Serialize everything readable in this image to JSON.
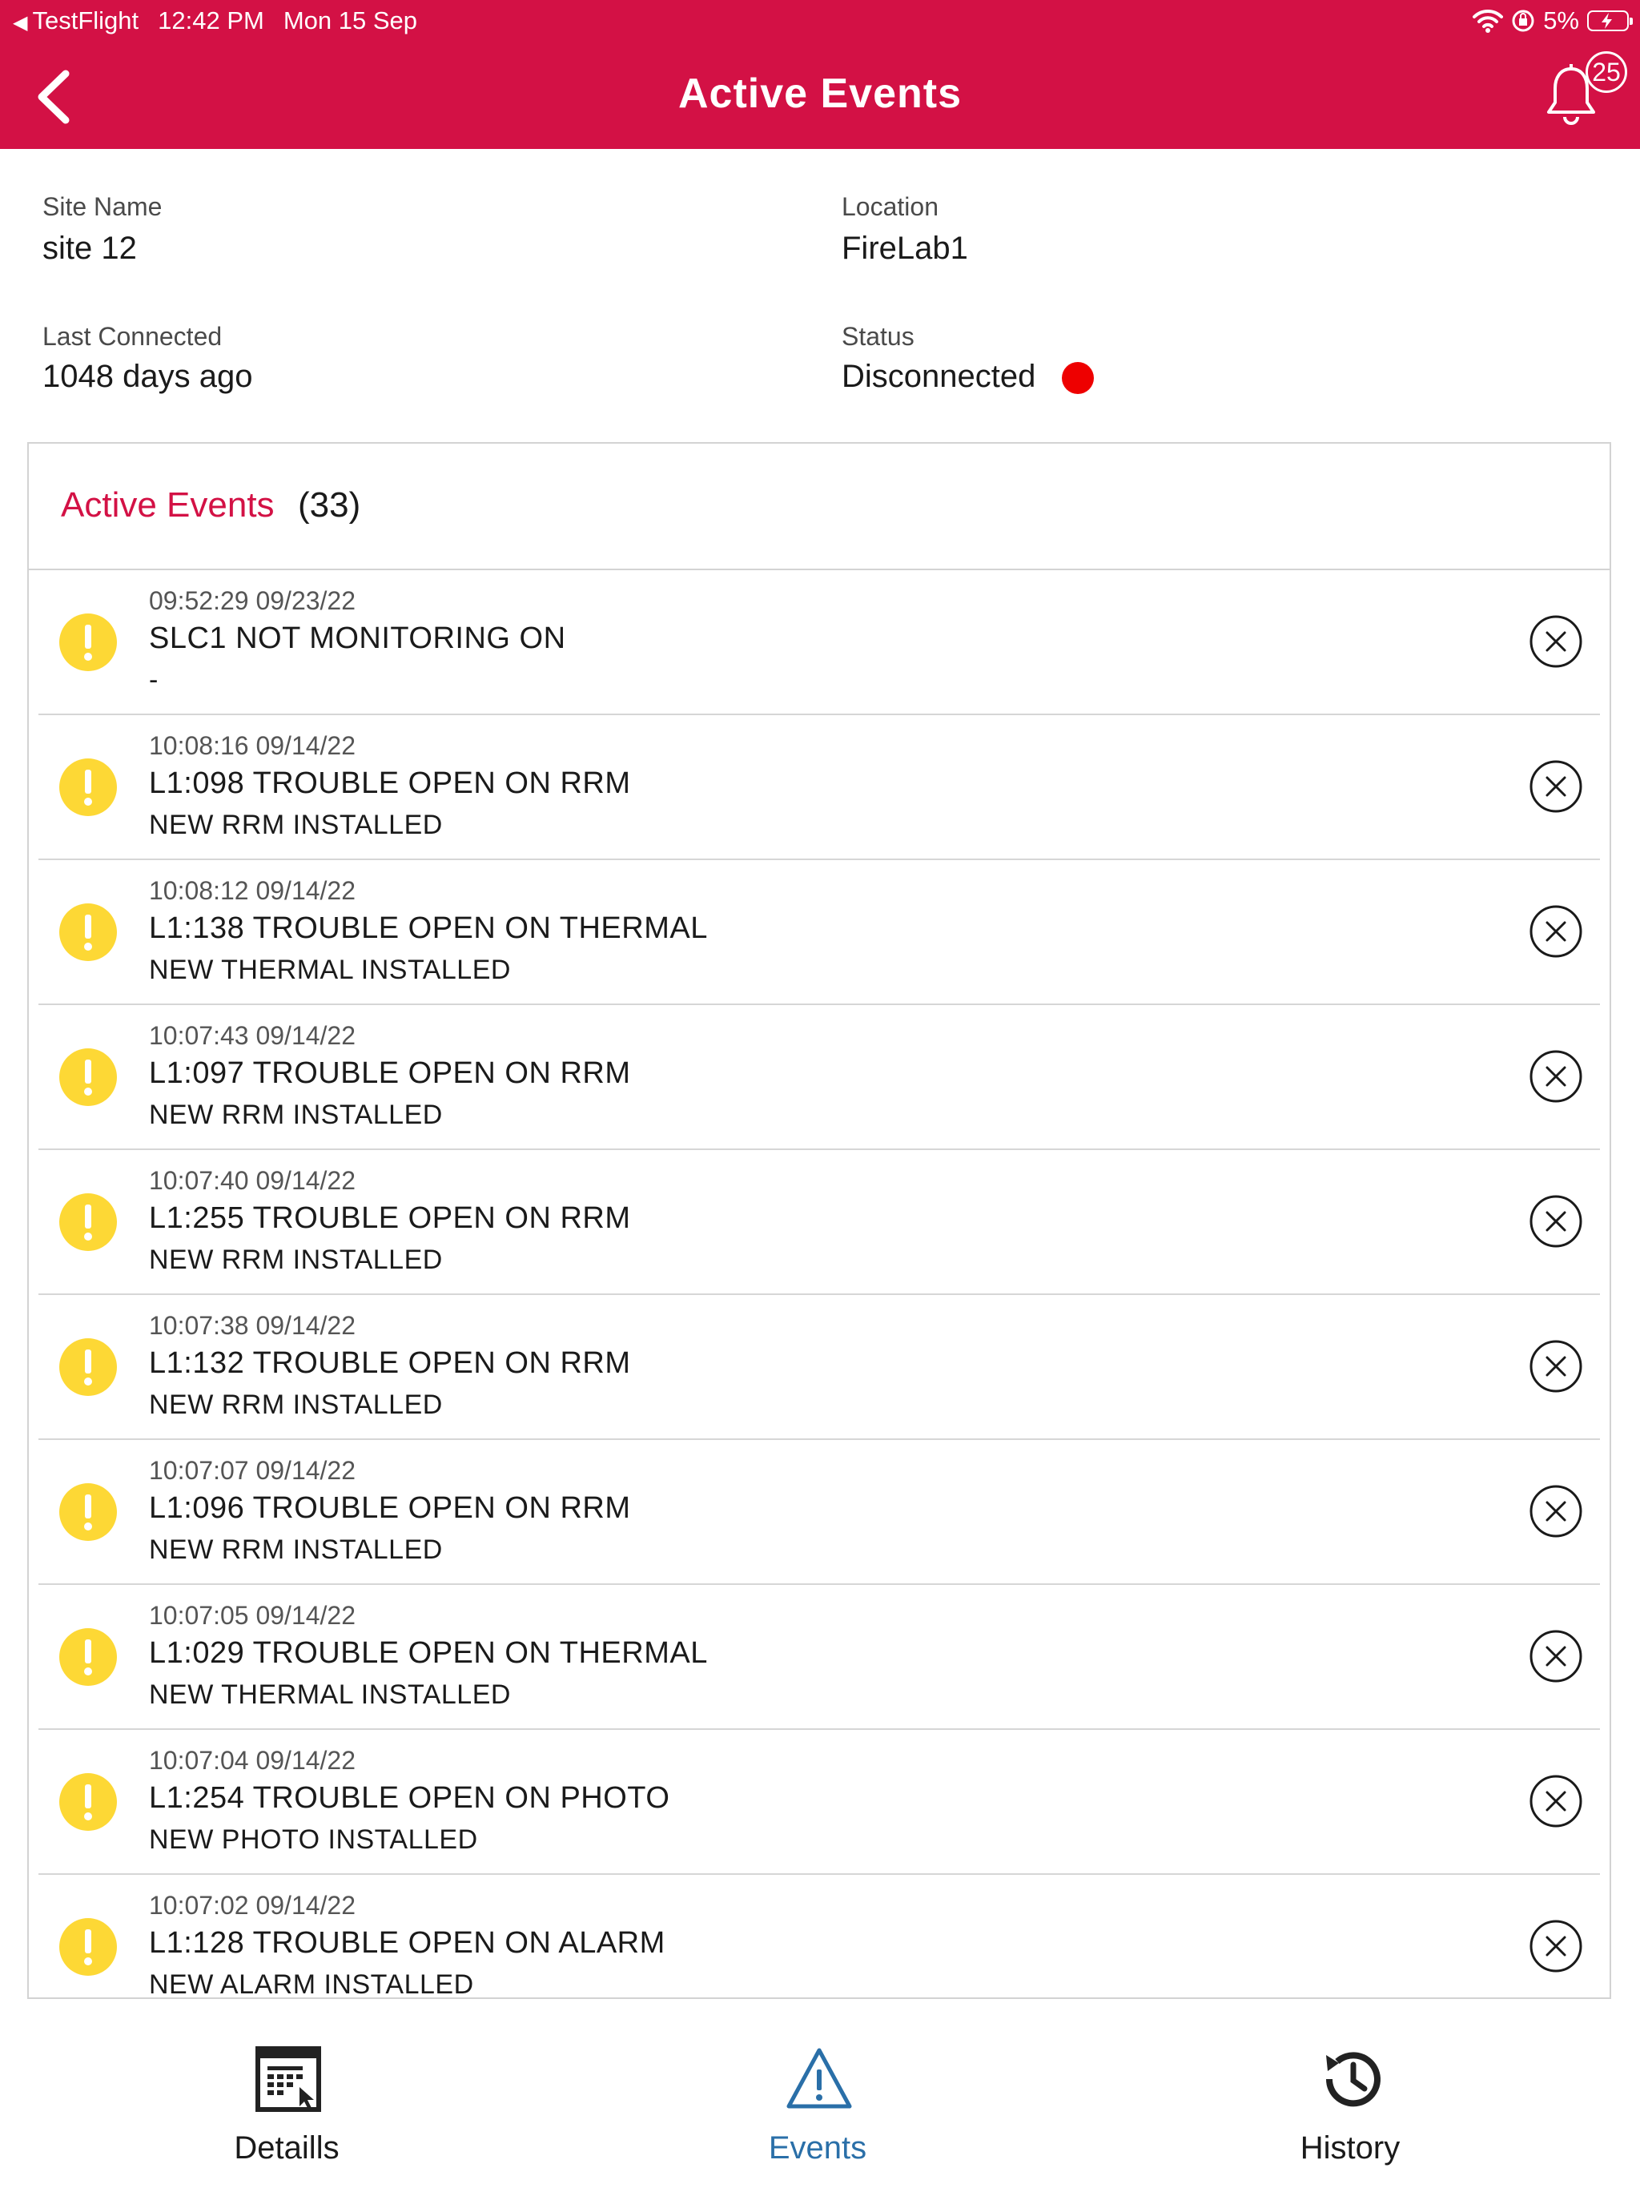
{
  "status_bar": {
    "back_app": "TestFlight",
    "time": "12:42 PM",
    "date": "Mon 15 Sep",
    "battery": "5%"
  },
  "nav": {
    "title": "Active Events",
    "notification_count": "25"
  },
  "site": {
    "site_name_label": "Site Name",
    "site_name": "site 12",
    "location_label": "Location",
    "location": "FireLab1",
    "last_connected_label": "Last Connected",
    "last_connected": "1048 days ago",
    "status_label": "Status",
    "status": "Disconnected",
    "status_color": "#ee0000"
  },
  "events_card": {
    "title": "Active Events",
    "count": "(33)",
    "events": [
      {
        "time": "09:52:29 09/23/22",
        "title": "SLC1 NOT MONITORING ON",
        "desc": "-"
      },
      {
        "time": "10:08:16 09/14/22",
        "title": "L1:098 TROUBLE OPEN ON RRM",
        "desc": "NEW RRM INSTALLED"
      },
      {
        "time": "10:08:12 09/14/22",
        "title": "L1:138 TROUBLE OPEN ON THERMAL",
        "desc": "NEW THERMAL INSTALLED"
      },
      {
        "time": "10:07:43 09/14/22",
        "title": "L1:097 TROUBLE OPEN ON RRM",
        "desc": "NEW RRM INSTALLED"
      },
      {
        "time": "10:07:40 09/14/22",
        "title": "L1:255 TROUBLE OPEN ON RRM",
        "desc": "NEW RRM INSTALLED"
      },
      {
        "time": "10:07:38 09/14/22",
        "title": "L1:132 TROUBLE OPEN ON RRM",
        "desc": "NEW RRM INSTALLED"
      },
      {
        "time": "10:07:07 09/14/22",
        "title": "L1:096 TROUBLE OPEN ON RRM",
        "desc": "NEW RRM INSTALLED"
      },
      {
        "time": "10:07:05 09/14/22",
        "title": "L1:029 TROUBLE OPEN ON THERMAL",
        "desc": "NEW THERMAL INSTALLED"
      },
      {
        "time": "10:07:04 09/14/22",
        "title": "L1:254 TROUBLE OPEN ON PHOTO",
        "desc": "NEW PHOTO INSTALLED"
      },
      {
        "time": "10:07:02 09/14/22",
        "title": "L1:128 TROUBLE OPEN ON ALARM",
        "desc": "NEW ALARM INSTALLED"
      }
    ]
  },
  "tabs": [
    {
      "label": "Detaills",
      "icon": "details-icon",
      "active": false
    },
    {
      "label": "Events",
      "icon": "warning-triangle-icon",
      "active": true
    },
    {
      "label": "History",
      "icon": "history-icon",
      "active": false
    }
  ],
  "colors": {
    "brand": "#d31145",
    "warning": "#fdd835",
    "active_tab": "#2a6fa8"
  }
}
